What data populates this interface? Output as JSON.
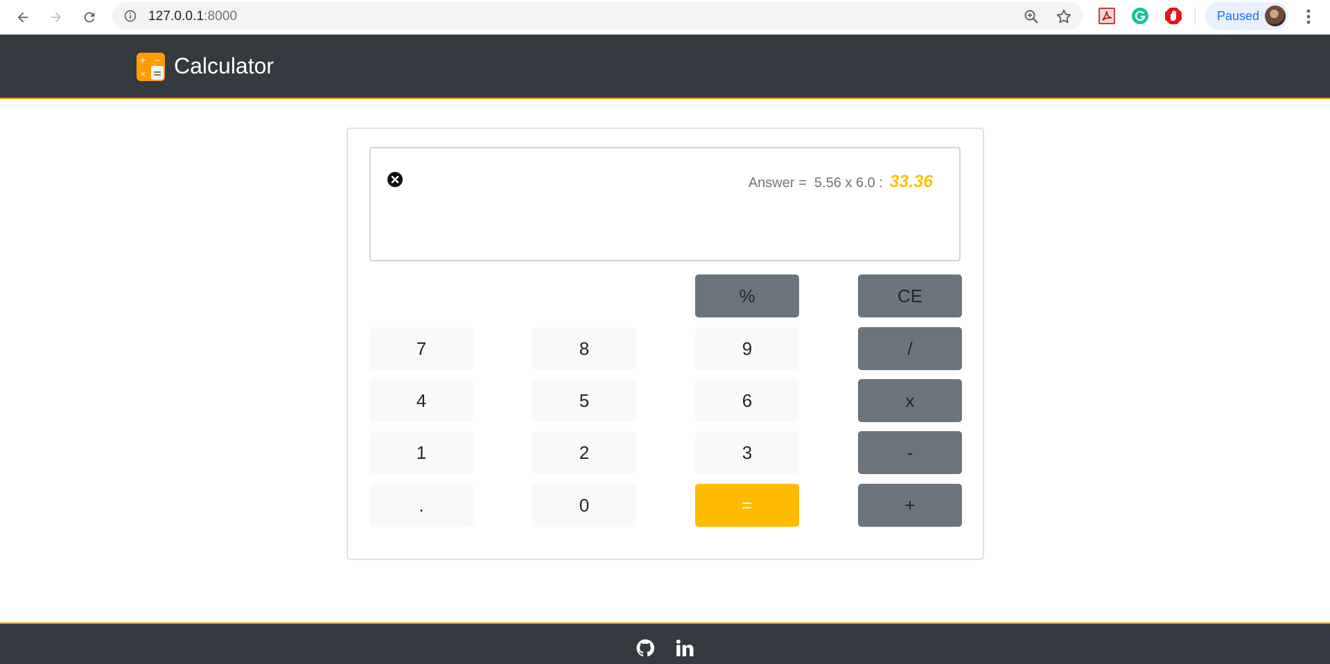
{
  "browser": {
    "url_host": "127.0.0.1",
    "url_port": ":8000",
    "profile_label": "Paused"
  },
  "header": {
    "brand": "Calculator",
    "accent_color": "#f0a500"
  },
  "display": {
    "prefix": "Answer =",
    "expression": "5.56 x 6.0 :",
    "result": "33.36",
    "result_color": "#ffc107"
  },
  "keys": {
    "percent": "%",
    "clear_entry": "CE",
    "k7": "7",
    "k8": "8",
    "k9": "9",
    "divide": "/",
    "k4": "4",
    "k5": "5",
    "k6": "6",
    "multiply": "x",
    "k1": "1",
    "k2": "2",
    "k3": "3",
    "minus": "-",
    "dot": ".",
    "k0": "0",
    "equals": "=",
    "plus": "+"
  },
  "footer": {
    "icons": [
      "github-icon",
      "linkedin-icon"
    ]
  }
}
